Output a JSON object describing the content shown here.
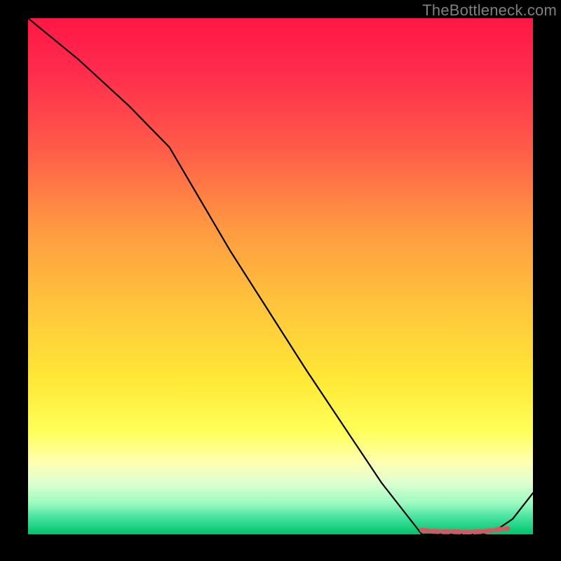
{
  "watermark": "TheBottleneck.com",
  "chart_data": {
    "type": "line",
    "title": "",
    "xlabel": "",
    "ylabel": "",
    "xlim": [
      0,
      100
    ],
    "ylim": [
      0,
      100
    ],
    "grid": false,
    "legend": false,
    "series": [
      {
        "name": "main-curve",
        "color": "#000000",
        "x": [
          0,
          10,
          20,
          28,
          40,
          55,
          70,
          78,
          80,
          83,
          86,
          90,
          93,
          96,
          100
        ],
        "y": [
          100,
          92,
          83,
          75,
          55,
          32,
          10,
          0,
          0,
          0,
          0,
          0,
          1,
          3,
          8
        ]
      },
      {
        "name": "bottom-markers",
        "color": "#d05a62",
        "type": "scatter",
        "x": [
          78,
          80,
          82.5,
          85,
          87,
          89,
          91,
          93,
          95
        ],
        "y": [
          0.8,
          0.6,
          0.5,
          0.5,
          0.4,
          0.5,
          0.6,
          0.9,
          1.1
        ]
      }
    ],
    "gradient_stops": [
      {
        "pos": 0.0,
        "color": "#ff1745"
      },
      {
        "pos": 0.1,
        "color": "#ff2b4d"
      },
      {
        "pos": 0.25,
        "color": "#ff5a49"
      },
      {
        "pos": 0.4,
        "color": "#ff9742"
      },
      {
        "pos": 0.55,
        "color": "#ffc33c"
      },
      {
        "pos": 0.7,
        "color": "#ffe836"
      },
      {
        "pos": 0.8,
        "color": "#ffff58"
      },
      {
        "pos": 0.86,
        "color": "#ffffb0"
      },
      {
        "pos": 0.9,
        "color": "#dfffd0"
      },
      {
        "pos": 0.94,
        "color": "#9bfac0"
      },
      {
        "pos": 0.97,
        "color": "#3fdf9b"
      },
      {
        "pos": 1.0,
        "color": "#00c36a"
      }
    ]
  }
}
